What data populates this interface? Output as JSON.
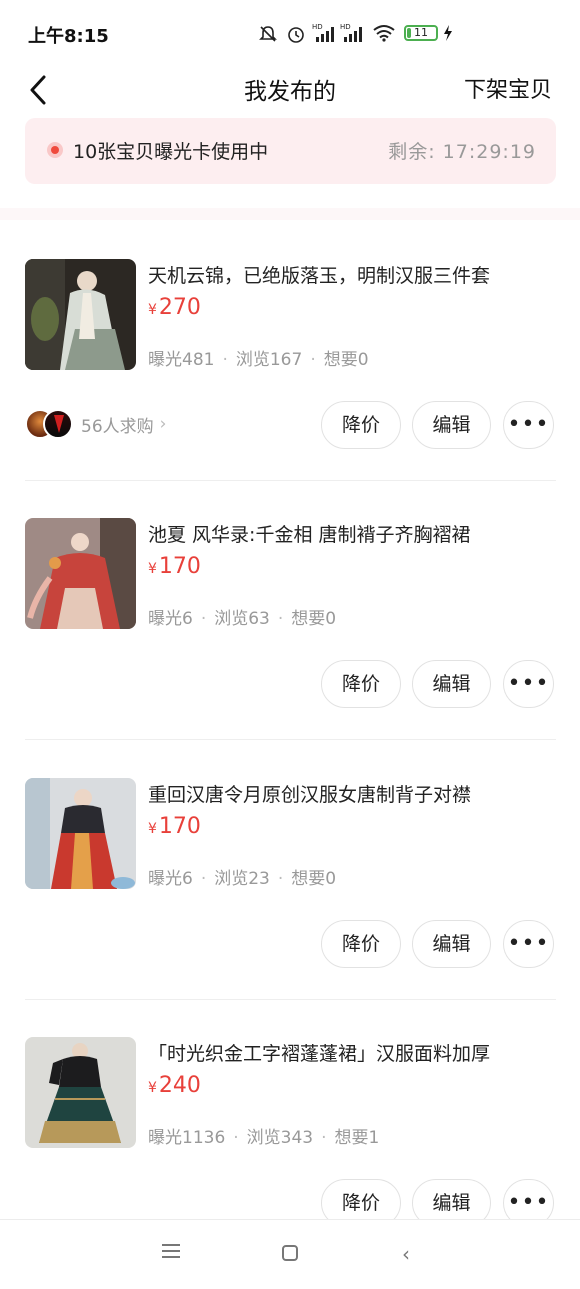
{
  "status_bar": {
    "time": "上午8:15",
    "battery_level": "11",
    "icons": [
      "mute-icon",
      "alarm-icon",
      "signal-hd-icon",
      "signal-hd-icon",
      "wifi-icon",
      "battery-icon",
      "charging-icon"
    ]
  },
  "nav": {
    "title": "我发布的",
    "action_label": "下架宝贝"
  },
  "promo": {
    "text": "10张宝贝曝光卡使用中",
    "remaining": "剩余: 17:29:19"
  },
  "listings": [
    {
      "title": "天机云锦，已绝版落玉，明制汉服三件套",
      "currency": "¥",
      "price": "270",
      "exposure": "曝光481",
      "views": "浏览167",
      "wants": "想要0",
      "buyers_text": "56人求购",
      "btn_price": "降价",
      "btn_edit": "编辑"
    },
    {
      "title": "池夏 风华录:千金相 唐制褙子齐胸褶裙",
      "currency": "¥",
      "price": "170",
      "exposure": "曝光6",
      "views": "浏览63",
      "wants": "想要0",
      "btn_price": "降价",
      "btn_edit": "编辑"
    },
    {
      "title": "重回汉唐令月原创汉服女唐制背子对襟",
      "currency": "¥",
      "price": "170",
      "exposure": "曝光6",
      "views": "浏览23",
      "wants": "想要0",
      "btn_price": "降价",
      "btn_edit": "编辑"
    },
    {
      "title": "「时光织金工字褶蓬蓬裙」汉服面料加厚",
      "currency": "¥",
      "price": "240",
      "exposure": "曝光1136",
      "views": "浏览343",
      "wants": "想要1",
      "btn_price": "降价",
      "btn_edit": "编辑"
    }
  ],
  "colors": {
    "accent_price": "#e8403a",
    "promo_bg": "#fdeef0",
    "muted_text": "#999999"
  }
}
